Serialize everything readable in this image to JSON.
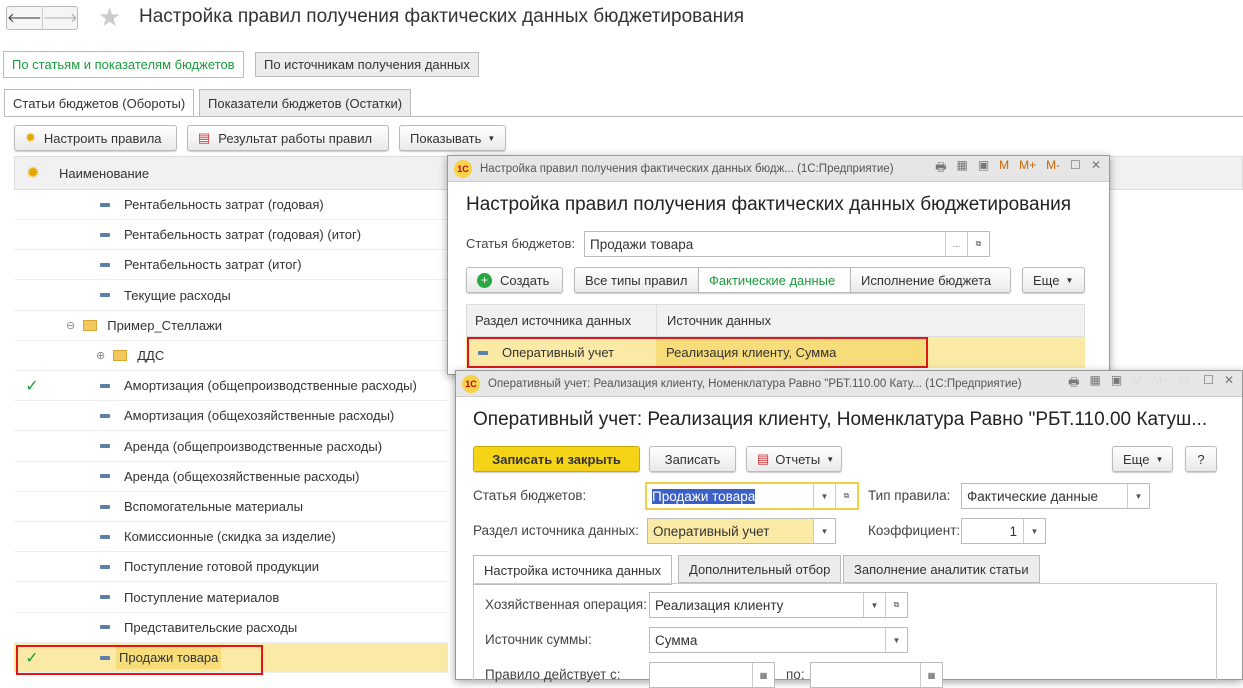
{
  "header": {
    "title": "Настройка правил получения фактических данных бюджетирования"
  },
  "top_tabs": [
    "По статьям и показателям бюджетов",
    "По источникам получения данных"
  ],
  "sub_tabs": [
    "Статьи бюджетов (Обороты)",
    "Показатели бюджетов (Остатки)"
  ],
  "toolbar": {
    "configure": "Настроить правила",
    "result": "Результат работы правил",
    "show": "Показывать"
  },
  "list": {
    "column": "Наименование",
    "rows": [
      {
        "label": "Рентабельность затрат (годовая)",
        "type": "item",
        "level": 2,
        "check": false
      },
      {
        "label": "Рентабельность затрат (годовая) (итог)",
        "type": "item",
        "level": 2,
        "check": false
      },
      {
        "label": "Рентабельность затрат (итог)",
        "type": "item",
        "level": 2,
        "check": false
      },
      {
        "label": "Текущие расходы",
        "type": "item",
        "level": 2,
        "check": false
      },
      {
        "label": "Пример_Стеллажи",
        "type": "folder",
        "level": 1,
        "expander": "⊖",
        "check": false
      },
      {
        "label": "ДДС",
        "type": "folder",
        "level": 2,
        "expander": "⊕",
        "check": false
      },
      {
        "label": "Амортизация (общепроизводственные расходы)",
        "type": "item",
        "level": 2,
        "check": true
      },
      {
        "label": "Амортизация (общехозяйственные расходы)",
        "type": "item",
        "level": 2,
        "check": false
      },
      {
        "label": "Аренда (общепроизводственные расходы)",
        "type": "item",
        "level": 2,
        "check": false
      },
      {
        "label": "Аренда (общехозяйственные расходы)",
        "type": "item",
        "level": 2,
        "check": false
      },
      {
        "label": "Вспомогательные материалы",
        "type": "item",
        "level": 2,
        "check": false
      },
      {
        "label": "Комиссионные (скидка за изделие)",
        "type": "item",
        "level": 2,
        "check": false
      },
      {
        "label": "Поступление готовой продукции",
        "type": "item",
        "level": 2,
        "check": false
      },
      {
        "label": "Поступление материалов",
        "type": "item",
        "level": 2,
        "check": false
      },
      {
        "label": "Представительские расходы",
        "type": "item",
        "level": 2,
        "check": false
      },
      {
        "label": "Продажи товара",
        "type": "item",
        "level": 2,
        "check": true,
        "selected": true
      }
    ]
  },
  "win1": {
    "titlebar": "Настройка правил получения фактических данных бюдж... (1С:Предприятие)",
    "title": "Настройка правил получения фактических данных бюджетирования",
    "article_label": "Статья бюджетов:",
    "article_value": "Продажи товара",
    "create": "Создать",
    "filters": [
      "Все типы правил",
      "Фактические данные",
      "Исполнение бюджета"
    ],
    "more": "Еще",
    "columns": [
      "Раздел источника данных",
      "Источник данных"
    ],
    "row": [
      "Оперативный учет",
      "Реализация клиенту, Сумма"
    ]
  },
  "win2": {
    "titlebar": "Оперативный учет: Реализация клиенту, Номенклатура Равно \"РБТ.110.00 Кату... (1С:Предприятие)",
    "title": "Оперативный учет: Реализация клиенту, Номенклатура Равно \"РБТ.110.00 Катуш...",
    "save_close": "Записать и закрыть",
    "save": "Записать",
    "reports": "Отчеты",
    "more": "Еще",
    "help": "?",
    "article_label": "Статья бюджетов:",
    "article_value": "Продажи товара",
    "rule_type_label": "Тип правила:",
    "rule_type_value": "Фактические данные",
    "section_label": "Раздел источника данных:",
    "section_value": "Оперативный учет",
    "coef_label": "Коэффициент:",
    "coef_value": "1",
    "tabs": [
      "Настройка источника данных",
      "Дополнительный отбор",
      "Заполнение аналитик статьи"
    ],
    "operation_label": "Хозяйственная операция:",
    "operation_value": "Реализация клиенту",
    "sum_label": "Источник суммы:",
    "sum_value": "Сумма",
    "from_label": "Правило действует с:",
    "to_label": "по:"
  },
  "colors": {
    "accent_green": "#1a9c3e",
    "highlight": "#fbeaa5",
    "red": "#e0161b",
    "yellow_btn": "#f5d418"
  }
}
